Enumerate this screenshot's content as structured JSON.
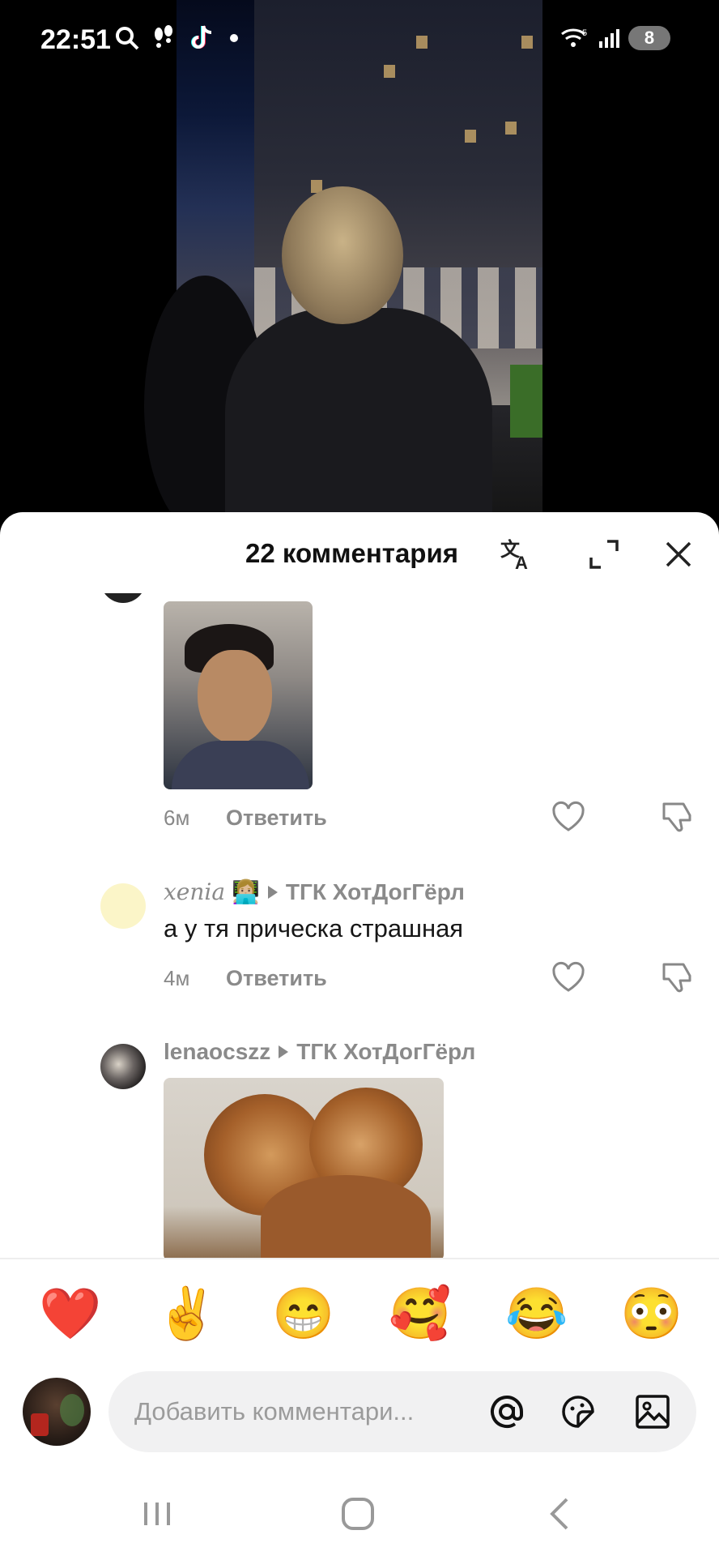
{
  "status_bar": {
    "time": "22:51",
    "battery": "8",
    "icons": [
      "search-icon",
      "steps-icon",
      "tiktok-icon",
      "dot-icon",
      "wifi-icon",
      "signal-icon",
      "battery-icon"
    ]
  },
  "sheet": {
    "title": "22 комментария",
    "header_icons": [
      "translate-icon",
      "expand-icon",
      "close-icon"
    ]
  },
  "comments": [
    {
      "username": "",
      "text": "",
      "has_image": true,
      "image_desc_icon": "photo-man-portrait",
      "time": "6м",
      "reply_label": "Ответить"
    },
    {
      "username": "xenia",
      "username_emoji": "👩🏼‍💻",
      "reply_to": "ТГК ХотДогГёрл",
      "text": "а у тя прическа страшная",
      "time": "4м",
      "reply_label": "Ответить"
    },
    {
      "username": "lenaocszz",
      "reply_to": "ТГК ХотДогГёрл",
      "text": "",
      "has_image": true,
      "image_desc_icon": "photo-lions"
    }
  ],
  "quick_emojis": [
    "❤️",
    "✌️",
    "😁",
    "🥰",
    "😂",
    "😳"
  ],
  "input": {
    "placeholder": "Добавить комментари...",
    "icons": [
      "mention-icon",
      "sticker-icon",
      "image-icon"
    ]
  },
  "navbar": {
    "buttons": [
      "recents-button",
      "home-button",
      "back-button"
    ]
  }
}
